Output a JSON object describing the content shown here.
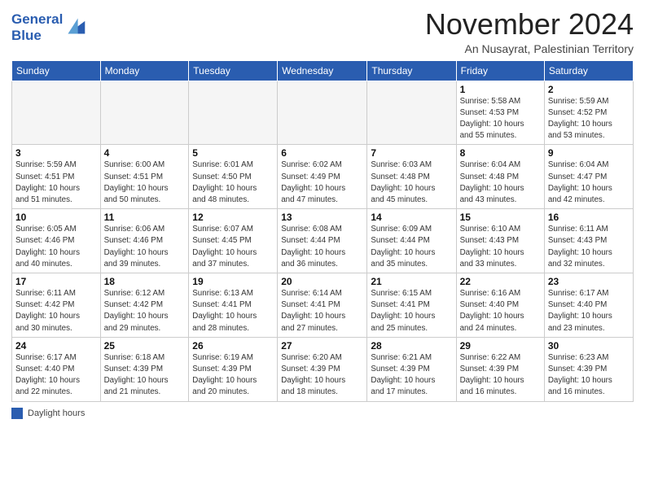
{
  "logo": {
    "line1": "General",
    "line2": "Blue"
  },
  "title": "November 2024",
  "subtitle": "An Nusayrat, Palestinian Territory",
  "days_of_week": [
    "Sunday",
    "Monday",
    "Tuesday",
    "Wednesday",
    "Thursday",
    "Friday",
    "Saturday"
  ],
  "weeks": [
    [
      {
        "num": "",
        "info": ""
      },
      {
        "num": "",
        "info": ""
      },
      {
        "num": "",
        "info": ""
      },
      {
        "num": "",
        "info": ""
      },
      {
        "num": "",
        "info": ""
      },
      {
        "num": "1",
        "info": "Sunrise: 5:58 AM\nSunset: 4:53 PM\nDaylight: 10 hours\nand 55 minutes."
      },
      {
        "num": "2",
        "info": "Sunrise: 5:59 AM\nSunset: 4:52 PM\nDaylight: 10 hours\nand 53 minutes."
      }
    ],
    [
      {
        "num": "3",
        "info": "Sunrise: 5:59 AM\nSunset: 4:51 PM\nDaylight: 10 hours\nand 51 minutes."
      },
      {
        "num": "4",
        "info": "Sunrise: 6:00 AM\nSunset: 4:51 PM\nDaylight: 10 hours\nand 50 minutes."
      },
      {
        "num": "5",
        "info": "Sunrise: 6:01 AM\nSunset: 4:50 PM\nDaylight: 10 hours\nand 48 minutes."
      },
      {
        "num": "6",
        "info": "Sunrise: 6:02 AM\nSunset: 4:49 PM\nDaylight: 10 hours\nand 47 minutes."
      },
      {
        "num": "7",
        "info": "Sunrise: 6:03 AM\nSunset: 4:48 PM\nDaylight: 10 hours\nand 45 minutes."
      },
      {
        "num": "8",
        "info": "Sunrise: 6:04 AM\nSunset: 4:48 PM\nDaylight: 10 hours\nand 43 minutes."
      },
      {
        "num": "9",
        "info": "Sunrise: 6:04 AM\nSunset: 4:47 PM\nDaylight: 10 hours\nand 42 minutes."
      }
    ],
    [
      {
        "num": "10",
        "info": "Sunrise: 6:05 AM\nSunset: 4:46 PM\nDaylight: 10 hours\nand 40 minutes."
      },
      {
        "num": "11",
        "info": "Sunrise: 6:06 AM\nSunset: 4:46 PM\nDaylight: 10 hours\nand 39 minutes."
      },
      {
        "num": "12",
        "info": "Sunrise: 6:07 AM\nSunset: 4:45 PM\nDaylight: 10 hours\nand 37 minutes."
      },
      {
        "num": "13",
        "info": "Sunrise: 6:08 AM\nSunset: 4:44 PM\nDaylight: 10 hours\nand 36 minutes."
      },
      {
        "num": "14",
        "info": "Sunrise: 6:09 AM\nSunset: 4:44 PM\nDaylight: 10 hours\nand 35 minutes."
      },
      {
        "num": "15",
        "info": "Sunrise: 6:10 AM\nSunset: 4:43 PM\nDaylight: 10 hours\nand 33 minutes."
      },
      {
        "num": "16",
        "info": "Sunrise: 6:11 AM\nSunset: 4:43 PM\nDaylight: 10 hours\nand 32 minutes."
      }
    ],
    [
      {
        "num": "17",
        "info": "Sunrise: 6:11 AM\nSunset: 4:42 PM\nDaylight: 10 hours\nand 30 minutes."
      },
      {
        "num": "18",
        "info": "Sunrise: 6:12 AM\nSunset: 4:42 PM\nDaylight: 10 hours\nand 29 minutes."
      },
      {
        "num": "19",
        "info": "Sunrise: 6:13 AM\nSunset: 4:41 PM\nDaylight: 10 hours\nand 28 minutes."
      },
      {
        "num": "20",
        "info": "Sunrise: 6:14 AM\nSunset: 4:41 PM\nDaylight: 10 hours\nand 27 minutes."
      },
      {
        "num": "21",
        "info": "Sunrise: 6:15 AM\nSunset: 4:41 PM\nDaylight: 10 hours\nand 25 minutes."
      },
      {
        "num": "22",
        "info": "Sunrise: 6:16 AM\nSunset: 4:40 PM\nDaylight: 10 hours\nand 24 minutes."
      },
      {
        "num": "23",
        "info": "Sunrise: 6:17 AM\nSunset: 4:40 PM\nDaylight: 10 hours\nand 23 minutes."
      }
    ],
    [
      {
        "num": "24",
        "info": "Sunrise: 6:17 AM\nSunset: 4:40 PM\nDaylight: 10 hours\nand 22 minutes."
      },
      {
        "num": "25",
        "info": "Sunrise: 6:18 AM\nSunset: 4:39 PM\nDaylight: 10 hours\nand 21 minutes."
      },
      {
        "num": "26",
        "info": "Sunrise: 6:19 AM\nSunset: 4:39 PM\nDaylight: 10 hours\nand 20 minutes."
      },
      {
        "num": "27",
        "info": "Sunrise: 6:20 AM\nSunset: 4:39 PM\nDaylight: 10 hours\nand 18 minutes."
      },
      {
        "num": "28",
        "info": "Sunrise: 6:21 AM\nSunset: 4:39 PM\nDaylight: 10 hours\nand 17 minutes."
      },
      {
        "num": "29",
        "info": "Sunrise: 6:22 AM\nSunset: 4:39 PM\nDaylight: 10 hours\nand 16 minutes."
      },
      {
        "num": "30",
        "info": "Sunrise: 6:23 AM\nSunset: 4:39 PM\nDaylight: 10 hours\nand 16 minutes."
      }
    ]
  ],
  "legend": {
    "label": "Daylight hours"
  }
}
